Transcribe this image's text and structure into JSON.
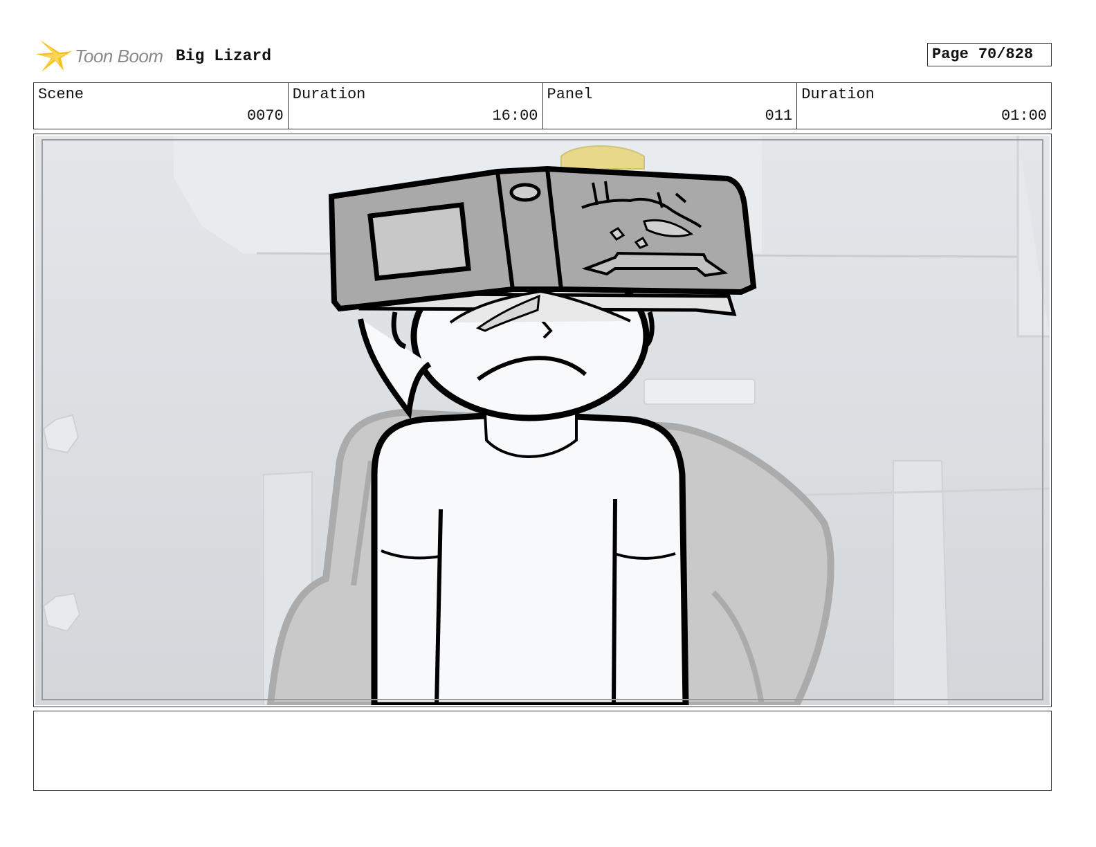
{
  "header": {
    "brand": "Toon Boom",
    "project_title": "Big Lizard",
    "page_label": "Page",
    "page_number": "70/828"
  },
  "info": {
    "scene_label": "Scene",
    "scene_value": "0070",
    "scene_duration_label": "Duration",
    "scene_duration_value": "16:00",
    "panel_label": "Panel",
    "panel_value": "011",
    "panel_duration_label": "Duration",
    "panel_duration_value": "01:00"
  },
  "colors": {
    "logo_yellow": "#f6c21c",
    "background_grey": "#dde1e4",
    "sketch_grey": "#b8b8b8"
  },
  "notes": ""
}
